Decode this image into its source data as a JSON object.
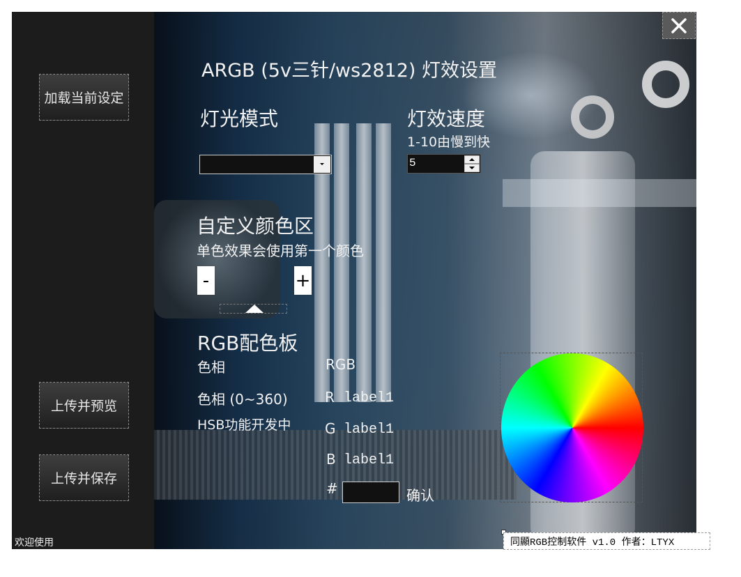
{
  "sidebar": {
    "load_button": "加载当前设定",
    "preview_button": "上传并预览",
    "save_button": "上传并保存",
    "welcome": "欢迎使用"
  },
  "header": {
    "title": "ARGB (5v三针/ws2812) 灯效设置",
    "close_icon": "close-icon"
  },
  "light_mode": {
    "label": "灯光模式",
    "selected": ""
  },
  "speed": {
    "label": "灯效速度",
    "hint": "1-10由慢到快",
    "value": "5"
  },
  "custom_color": {
    "label": "自定义颜色区",
    "hint": "单色效果会使用第一个颜色",
    "minus": "-",
    "plus": "+"
  },
  "palette": {
    "title": "RGB配色板",
    "hue_label": "色相",
    "hue_range": "色相 (0~360)",
    "hsb_note": "HSB功能开发中",
    "rgb_label": "RGB",
    "r": "R",
    "g": "G",
    "b": "B",
    "r_value": "label1",
    "g_value": "label1",
    "b_value": "label1",
    "hash": "#",
    "hex_value": "",
    "confirm": "确认"
  },
  "footer": {
    "info": "同顯RGB控制软件 v1.0 作者：LTYX"
  },
  "colors": {
    "panel": "#1b1b1b",
    "button_top": "#3e3e3e",
    "button_bottom": "#1f1f1f",
    "text": "#f2f2f2"
  }
}
